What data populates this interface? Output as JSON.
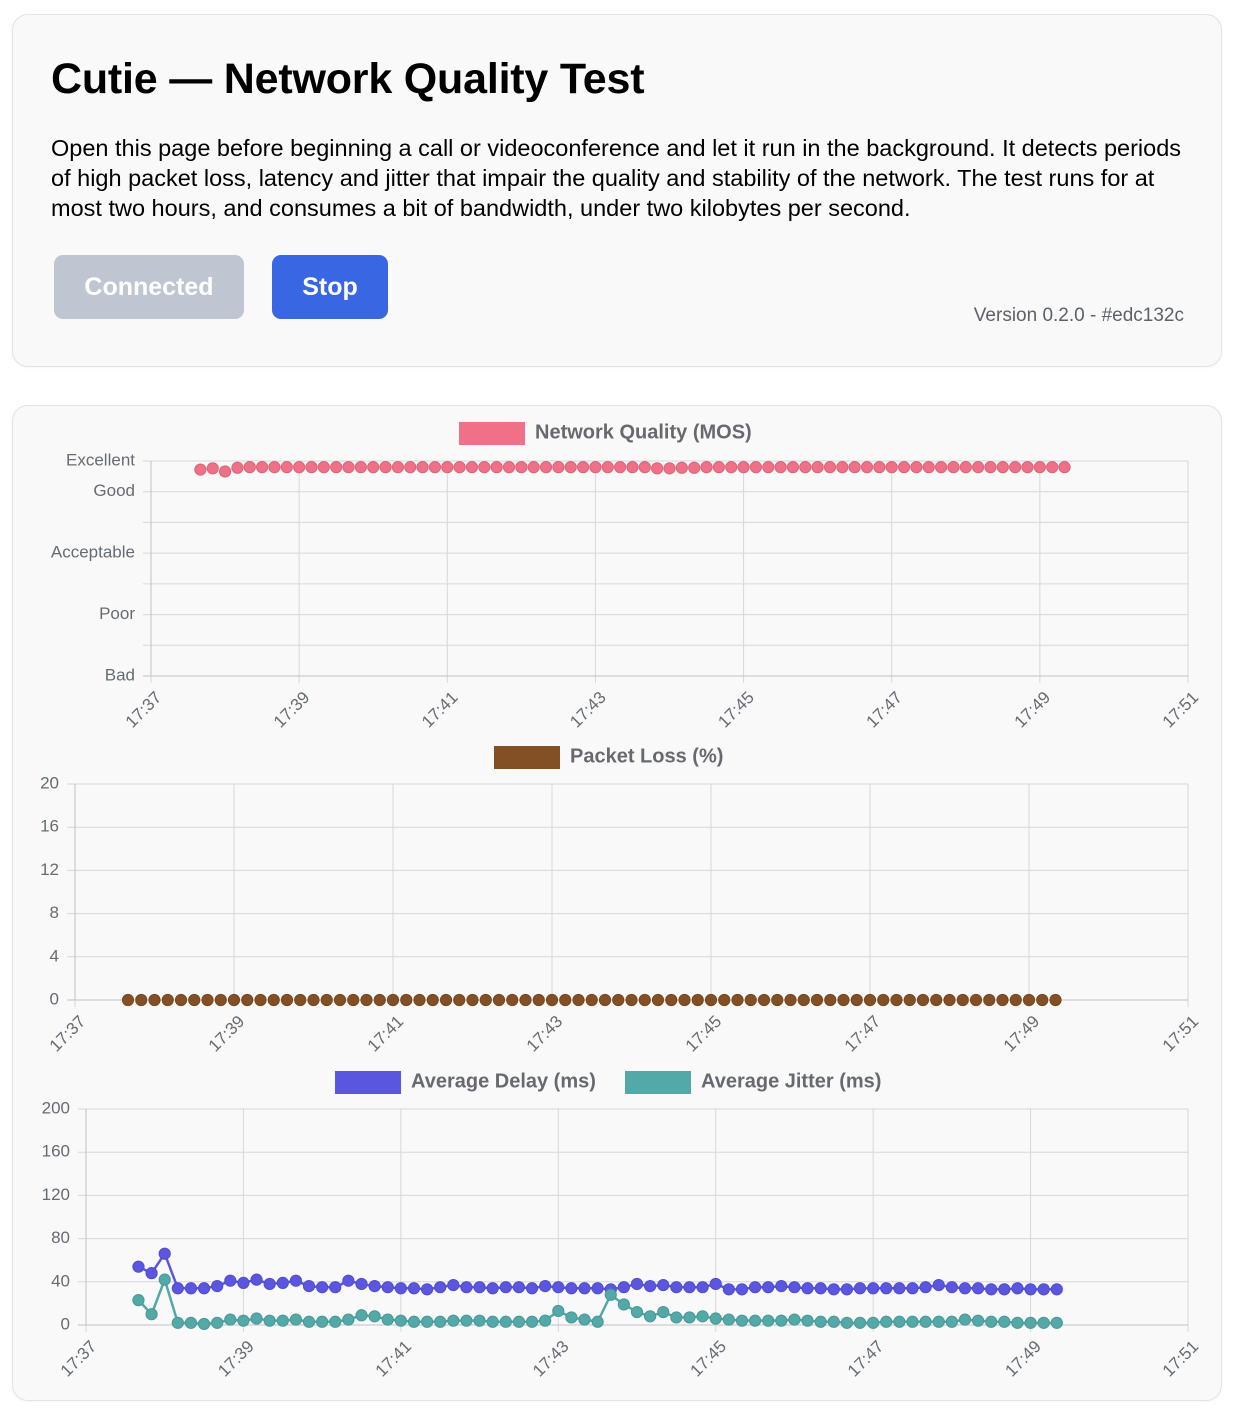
{
  "header": {
    "title": "Cutie — Network Quality Test",
    "description": "Open this page before beginning a call or videoconference and let it run in the background. It detects periods of high packet loss, latency and jitter that impair the quality and stability of the network. The test runs for at most two hours, and consumes a bit of bandwidth, under two kilobytes per second.",
    "connect_label": "Connected",
    "stop_label": "Stop",
    "version": "Version 0.2.0 - #edc132c"
  },
  "colors": {
    "mos": "#f07088",
    "loss": "#834f24",
    "delay": "#5b56e0",
    "jitter": "#53a8a8",
    "grid": "#d8d8dc",
    "tick": "#666c73"
  },
  "chart_data": [
    {
      "type": "scatter",
      "x_axis": {
        "ticks": [
          "17:37",
          "17:39",
          "17:41",
          "17:43",
          "17:45",
          "17:47",
          "17:49",
          "17:51"
        ],
        "range": [
          "17:37",
          "17:51"
        ]
      },
      "y_axis": {
        "tick_labels": [
          "Excellent",
          "Good",
          "Acceptable",
          "Poor",
          "Bad"
        ],
        "range": [
          1,
          4.5
        ]
      },
      "grid": true,
      "legend": "top-center",
      "series": [
        {
          "name": "Network Quality (MOS)",
          "x": [
            "17:37:40",
            "17:37:50",
            "17:38:00",
            "17:38:10",
            "17:38:20",
            "17:38:30",
            "17:38:40",
            "17:38:50",
            "17:39:00",
            "17:39:10",
            "17:39:20",
            "17:39:30",
            "17:39:40",
            "17:39:50",
            "17:40:00",
            "17:40:10",
            "17:40:20",
            "17:40:30",
            "17:40:40",
            "17:40:50",
            "17:41:00",
            "17:41:10",
            "17:41:20",
            "17:41:30",
            "17:41:40",
            "17:41:50",
            "17:42:00",
            "17:42:10",
            "17:42:20",
            "17:42:30",
            "17:42:40",
            "17:42:50",
            "17:43:00",
            "17:43:10",
            "17:43:20",
            "17:43:30",
            "17:43:40",
            "17:43:50",
            "17:44:00",
            "17:44:10",
            "17:44:20",
            "17:44:30",
            "17:44:40",
            "17:44:50",
            "17:45:00",
            "17:45:10",
            "17:45:20",
            "17:45:30",
            "17:45:40",
            "17:45:50",
            "17:46:00",
            "17:46:10",
            "17:46:20",
            "17:46:30",
            "17:46:40",
            "17:46:50",
            "17:47:00",
            "17:47:10",
            "17:47:20",
            "17:47:30",
            "17:47:40",
            "17:47:50",
            "17:48:00",
            "17:48:10",
            "17:48:20",
            "17:48:30",
            "17:48:40",
            "17:48:50",
            "17:49:00",
            "17:49:10",
            "17:49:20"
          ],
          "y": [
            4.36,
            4.38,
            4.33,
            4.39,
            4.4,
            4.4,
            4.4,
            4.4,
            4.4,
            4.4,
            4.4,
            4.4,
            4.4,
            4.4,
            4.4,
            4.4,
            4.4,
            4.4,
            4.4,
            4.4,
            4.4,
            4.4,
            4.4,
            4.4,
            4.4,
            4.4,
            4.4,
            4.4,
            4.4,
            4.4,
            4.4,
            4.4,
            4.4,
            4.4,
            4.4,
            4.4,
            4.4,
            4.38,
            4.38,
            4.39,
            4.39,
            4.4,
            4.4,
            4.4,
            4.4,
            4.4,
            4.4,
            4.4,
            4.4,
            4.4,
            4.4,
            4.4,
            4.4,
            4.4,
            4.4,
            4.4,
            4.4,
            4.4,
            4.4,
            4.4,
            4.4,
            4.4,
            4.4,
            4.4,
            4.4,
            4.4,
            4.4,
            4.4,
            4.4,
            4.4,
            4.4
          ]
        }
      ]
    },
    {
      "type": "scatter",
      "x_axis": {
        "ticks": [
          "17:37",
          "17:39",
          "17:41",
          "17:43",
          "17:45",
          "17:47",
          "17:49",
          "17:51"
        ],
        "range": [
          "17:37",
          "17:51"
        ]
      },
      "y_axis": {
        "ticks": [
          0,
          4,
          8,
          12,
          16,
          20
        ],
        "range": [
          0,
          20
        ]
      },
      "grid": true,
      "legend": "top-center",
      "series": [
        {
          "name": "Packet Loss (%)",
          "x": [
            "17:37:40",
            "17:37:50",
            "17:38:00",
            "17:38:10",
            "17:38:20",
            "17:38:30",
            "17:38:40",
            "17:38:50",
            "17:39:00",
            "17:39:10",
            "17:39:20",
            "17:39:30",
            "17:39:40",
            "17:39:50",
            "17:40:00",
            "17:40:10",
            "17:40:20",
            "17:40:30",
            "17:40:40",
            "17:40:50",
            "17:41:00",
            "17:41:10",
            "17:41:20",
            "17:41:30",
            "17:41:40",
            "17:41:50",
            "17:42:00",
            "17:42:10",
            "17:42:20",
            "17:42:30",
            "17:42:40",
            "17:42:50",
            "17:43:00",
            "17:43:10",
            "17:43:20",
            "17:43:30",
            "17:43:40",
            "17:43:50",
            "17:44:00",
            "17:44:10",
            "17:44:20",
            "17:44:30",
            "17:44:40",
            "17:44:50",
            "17:45:00",
            "17:45:10",
            "17:45:20",
            "17:45:30",
            "17:45:40",
            "17:45:50",
            "17:46:00",
            "17:46:10",
            "17:46:20",
            "17:46:30",
            "17:46:40",
            "17:46:50",
            "17:47:00",
            "17:47:10",
            "17:47:20",
            "17:47:30",
            "17:47:40",
            "17:47:50",
            "17:48:00",
            "17:48:10",
            "17:48:20",
            "17:48:30",
            "17:48:40",
            "17:48:50",
            "17:49:00",
            "17:49:10",
            "17:49:20"
          ],
          "y": [
            0,
            0,
            0,
            0,
            0,
            0,
            0,
            0,
            0,
            0,
            0,
            0,
            0,
            0,
            0,
            0,
            0,
            0,
            0,
            0,
            0,
            0,
            0,
            0,
            0,
            0,
            0,
            0,
            0,
            0,
            0,
            0,
            0,
            0,
            0,
            0,
            0,
            0,
            0,
            0,
            0,
            0,
            0,
            0,
            0,
            0,
            0,
            0,
            0,
            0,
            0,
            0,
            0,
            0,
            0,
            0,
            0,
            0,
            0,
            0,
            0,
            0,
            0,
            0,
            0,
            0,
            0,
            0,
            0,
            0,
            0
          ]
        }
      ]
    },
    {
      "type": "line",
      "x_axis": {
        "ticks": [
          "17:37",
          "17:39",
          "17:41",
          "17:43",
          "17:45",
          "17:47",
          "17:49",
          "17:51"
        ],
        "range": [
          "17:37",
          "17:51"
        ]
      },
      "y_axis": {
        "ticks": [
          0,
          40,
          80,
          120,
          160,
          200
        ],
        "range": [
          0,
          200
        ]
      },
      "grid": true,
      "legend": "top-center",
      "series": [
        {
          "name": "Average Delay (ms)",
          "x": [
            "17:37:40",
            "17:37:50",
            "17:38:00",
            "17:38:10",
            "17:38:20",
            "17:38:30",
            "17:38:40",
            "17:38:50",
            "17:39:00",
            "17:39:10",
            "17:39:20",
            "17:39:30",
            "17:39:40",
            "17:39:50",
            "17:40:00",
            "17:40:10",
            "17:40:20",
            "17:40:30",
            "17:40:40",
            "17:40:50",
            "17:41:00",
            "17:41:10",
            "17:41:20",
            "17:41:30",
            "17:41:40",
            "17:41:50",
            "17:42:00",
            "17:42:10",
            "17:42:20",
            "17:42:30",
            "17:42:40",
            "17:42:50",
            "17:43:00",
            "17:43:10",
            "17:43:20",
            "17:43:30",
            "17:43:40",
            "17:43:50",
            "17:44:00",
            "17:44:10",
            "17:44:20",
            "17:44:30",
            "17:44:40",
            "17:44:50",
            "17:45:00",
            "17:45:10",
            "17:45:20",
            "17:45:30",
            "17:45:40",
            "17:45:50",
            "17:46:00",
            "17:46:10",
            "17:46:20",
            "17:46:30",
            "17:46:40",
            "17:46:50",
            "17:47:00",
            "17:47:10",
            "17:47:20",
            "17:47:30",
            "17:47:40",
            "17:47:50",
            "17:48:00",
            "17:48:10",
            "17:48:20",
            "17:48:30",
            "17:48:40",
            "17:48:50",
            "17:49:00",
            "17:49:10",
            "17:49:20"
          ],
          "y": [
            54,
            48,
            66,
            34,
            34,
            34,
            36,
            41,
            39,
            42,
            38,
            39,
            41,
            36,
            35,
            35,
            41,
            38,
            36,
            35,
            34,
            34,
            33,
            35,
            37,
            35,
            35,
            34,
            35,
            35,
            34,
            36,
            35,
            34,
            34,
            34,
            33,
            35,
            38,
            36,
            37,
            35,
            35,
            35,
            38,
            33,
            33,
            35,
            35,
            36,
            35,
            34,
            34,
            33,
            33,
            34,
            34,
            34,
            34,
            34,
            35,
            37,
            35,
            34,
            34,
            33,
            33,
            34,
            33,
            33,
            33
          ]
        },
        {
          "name": "Average Jitter (ms)",
          "x": [
            "17:37:40",
            "17:37:50",
            "17:38:00",
            "17:38:10",
            "17:38:20",
            "17:38:30",
            "17:38:40",
            "17:38:50",
            "17:39:00",
            "17:39:10",
            "17:39:20",
            "17:39:30",
            "17:39:40",
            "17:39:50",
            "17:40:00",
            "17:40:10",
            "17:40:20",
            "17:40:30",
            "17:40:40",
            "17:40:50",
            "17:41:00",
            "17:41:10",
            "17:41:20",
            "17:41:30",
            "17:41:40",
            "17:41:50",
            "17:42:00",
            "17:42:10",
            "17:42:20",
            "17:42:30",
            "17:42:40",
            "17:42:50",
            "17:43:00",
            "17:43:10",
            "17:43:20",
            "17:43:30",
            "17:43:40",
            "17:43:50",
            "17:44:00",
            "17:44:10",
            "17:44:20",
            "17:44:30",
            "17:44:40",
            "17:44:50",
            "17:45:00",
            "17:45:10",
            "17:45:20",
            "17:45:30",
            "17:45:40",
            "17:45:50",
            "17:46:00",
            "17:46:10",
            "17:46:20",
            "17:46:30",
            "17:46:40",
            "17:46:50",
            "17:47:00",
            "17:47:10",
            "17:47:20",
            "17:47:30",
            "17:47:40",
            "17:47:50",
            "17:48:00",
            "17:48:10",
            "17:48:20",
            "17:48:30",
            "17:48:40",
            "17:48:50",
            "17:49:00",
            "17:49:10",
            "17:49:20"
          ],
          "y": [
            23,
            10,
            42,
            2,
            2,
            1,
            2,
            5,
            4,
            6,
            4,
            4,
            5,
            3,
            3,
            3,
            5,
            9,
            8,
            5,
            4,
            3,
            3,
            3,
            4,
            4,
            4,
            3,
            3,
            3,
            3,
            4,
            13,
            7,
            5,
            3,
            28,
            19,
            12,
            8,
            12,
            7,
            7,
            8,
            6,
            5,
            4,
            4,
            4,
            4,
            5,
            4,
            3,
            3,
            2,
            2,
            2,
            3,
            3,
            3,
            3,
            3,
            3,
            5,
            4,
            3,
            3,
            2,
            2,
            2,
            2
          ]
        }
      ]
    }
  ]
}
